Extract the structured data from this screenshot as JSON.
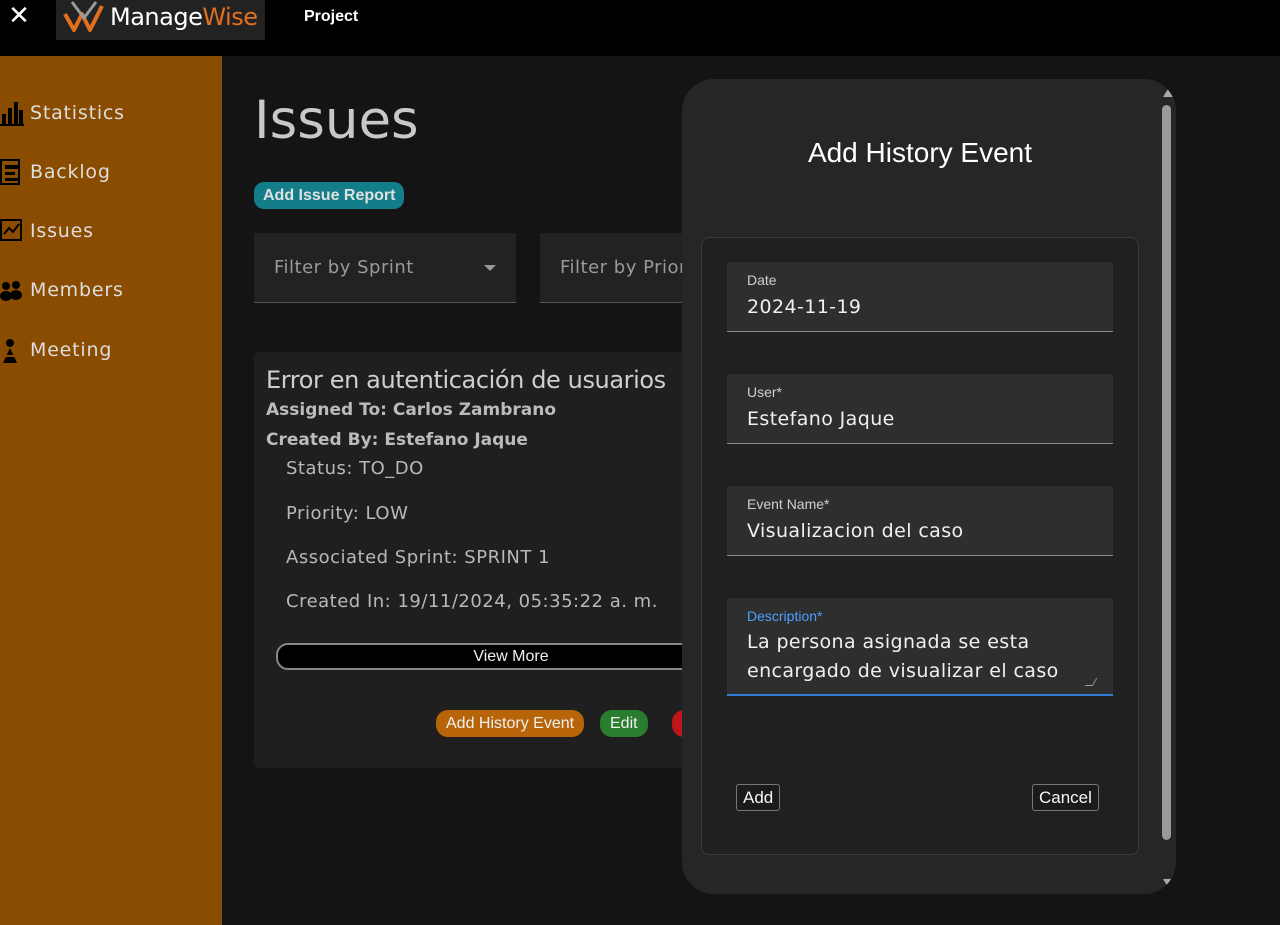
{
  "topbar": {
    "close_label": "✕",
    "logo_manage": "Manage",
    "logo_wise": "Wise",
    "project_label": "Project"
  },
  "sidebar": {
    "items": [
      {
        "label": "Statistics",
        "icon": "bar-chart-icon"
      },
      {
        "label": "Backlog",
        "icon": "backlog-icon"
      },
      {
        "label": "Issues",
        "icon": "issues-icon"
      },
      {
        "label": "Members",
        "icon": "members-icon"
      },
      {
        "label": "Meeting",
        "icon": "meeting-icon"
      }
    ]
  },
  "main": {
    "title": "Issues",
    "add_issue_label": "Add Issue Report",
    "filters": {
      "sprint_placeholder": "Filter by Sprint",
      "priority_placeholder": "Filter by Prior"
    },
    "issue": {
      "title": "Error en autenticación de usuarios",
      "assigned_to": "Assigned To: Carlos Zambrano",
      "created_by": "Created By: Estefano Jaque",
      "status": "Status: TO_DO",
      "priority": "Priority: LOW",
      "sprint": "Associated Sprint: SPRINT 1",
      "created_in": "Created In: 19/11/2024, 05:35:22 a. m.",
      "view_more_label": "View More",
      "add_history_label": "Add History Event",
      "edit_label": "Edit"
    }
  },
  "modal": {
    "title": "Add History Event",
    "fields": {
      "date_label": "Date",
      "date_value": "2024-11-19",
      "user_label": "User*",
      "user_value": "Estefano Jaque",
      "event_label": "Event Name*",
      "event_value": "Visualizacion del caso",
      "desc_label": "Description*",
      "desc_value": "La persona asignada se esta encargado de visualizar el caso"
    },
    "add_label": "Add",
    "cancel_label": "Cancel"
  },
  "colors": {
    "sidebar": "#8a4c00",
    "accent_teal": "#137d8a",
    "history_btn": "#b8650a",
    "edit_btn": "#2a7d2e",
    "delete_btn": "#c0151a",
    "focus_blue": "#2f7fd6"
  }
}
